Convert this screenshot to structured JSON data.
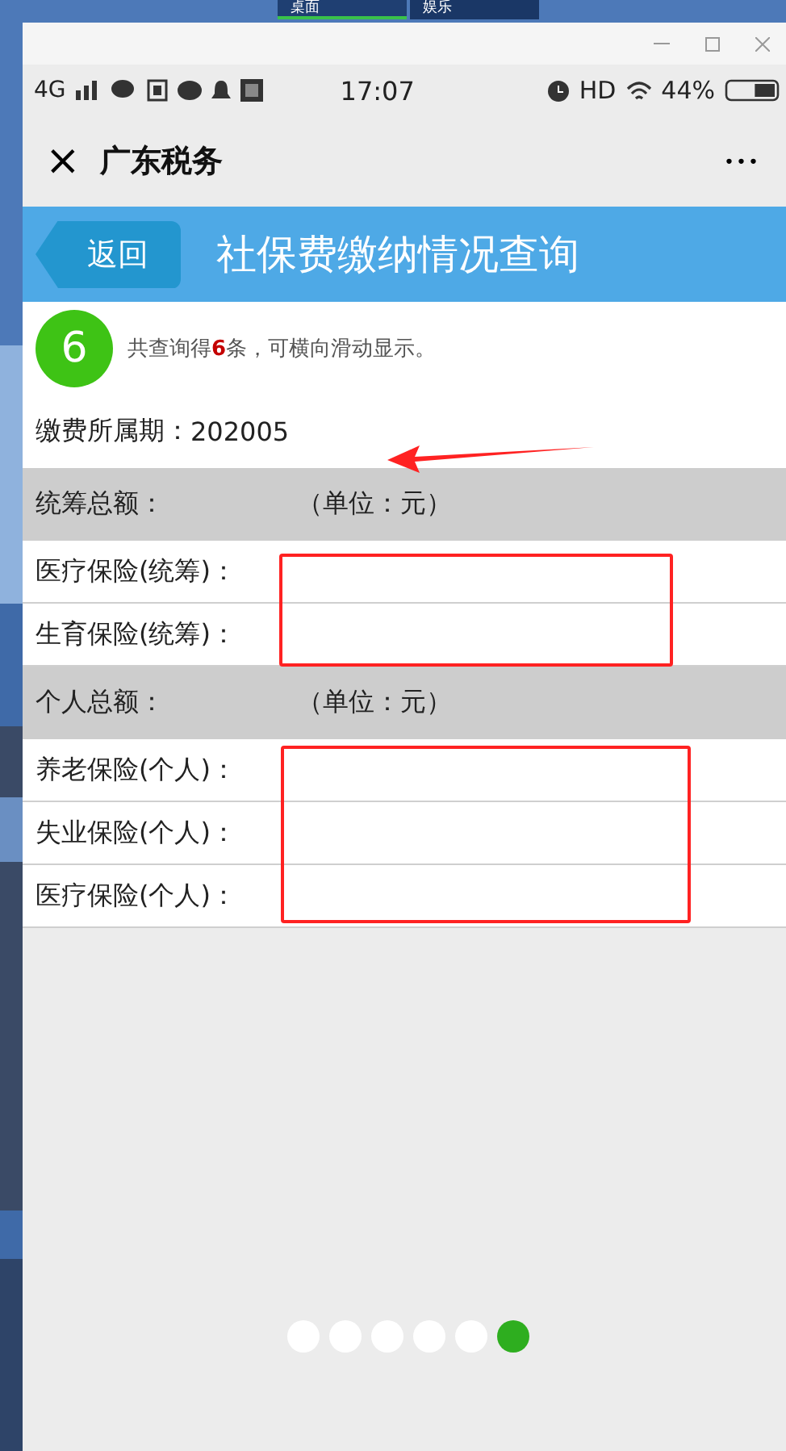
{
  "taskbar": {
    "tabs": [
      {
        "label": "桌面",
        "selected": true
      },
      {
        "label": "娱乐",
        "selected": false
      }
    ]
  },
  "status_bar": {
    "network": "4G",
    "time": "17:07",
    "hd": "HD",
    "battery_text": "44%",
    "battery": {
      "level": 0.44
    }
  },
  "nav": {
    "close": "×",
    "title": "广东税务",
    "more": "•••"
  },
  "header": {
    "back": "返回",
    "title": "社保费缴纳情况查询"
  },
  "summary": {
    "count": "6",
    "text": "共查询得**6**条，可横向滑动显示。"
  },
  "period": {
    "label": "缴费所属期：",
    "value": "202005"
  },
  "sections": [
    {
      "label": "统筹总额：",
      "unit": "（单位：元）",
      "rows": [
        {
          "label": "医疗保险(统筹)："
        },
        {
          "label": "生育保险(统筹)："
        }
      ]
    },
    {
      "label": "个人总额：",
      "unit": "（单位：元）",
      "rows": [
        {
          "label": "养老保险(个人)："
        },
        {
          "label": "失业保险(个人)："
        },
        {
          "label": "医疗保险(个人)："
        }
      ]
    }
  ],
  "pager": [
    {
      "selected": false
    },
    {
      "selected": false
    },
    {
      "selected": false
    },
    {
      "selected": false
    },
    {
      "selected": false
    },
    {
      "selected": true
    }
  ]
}
